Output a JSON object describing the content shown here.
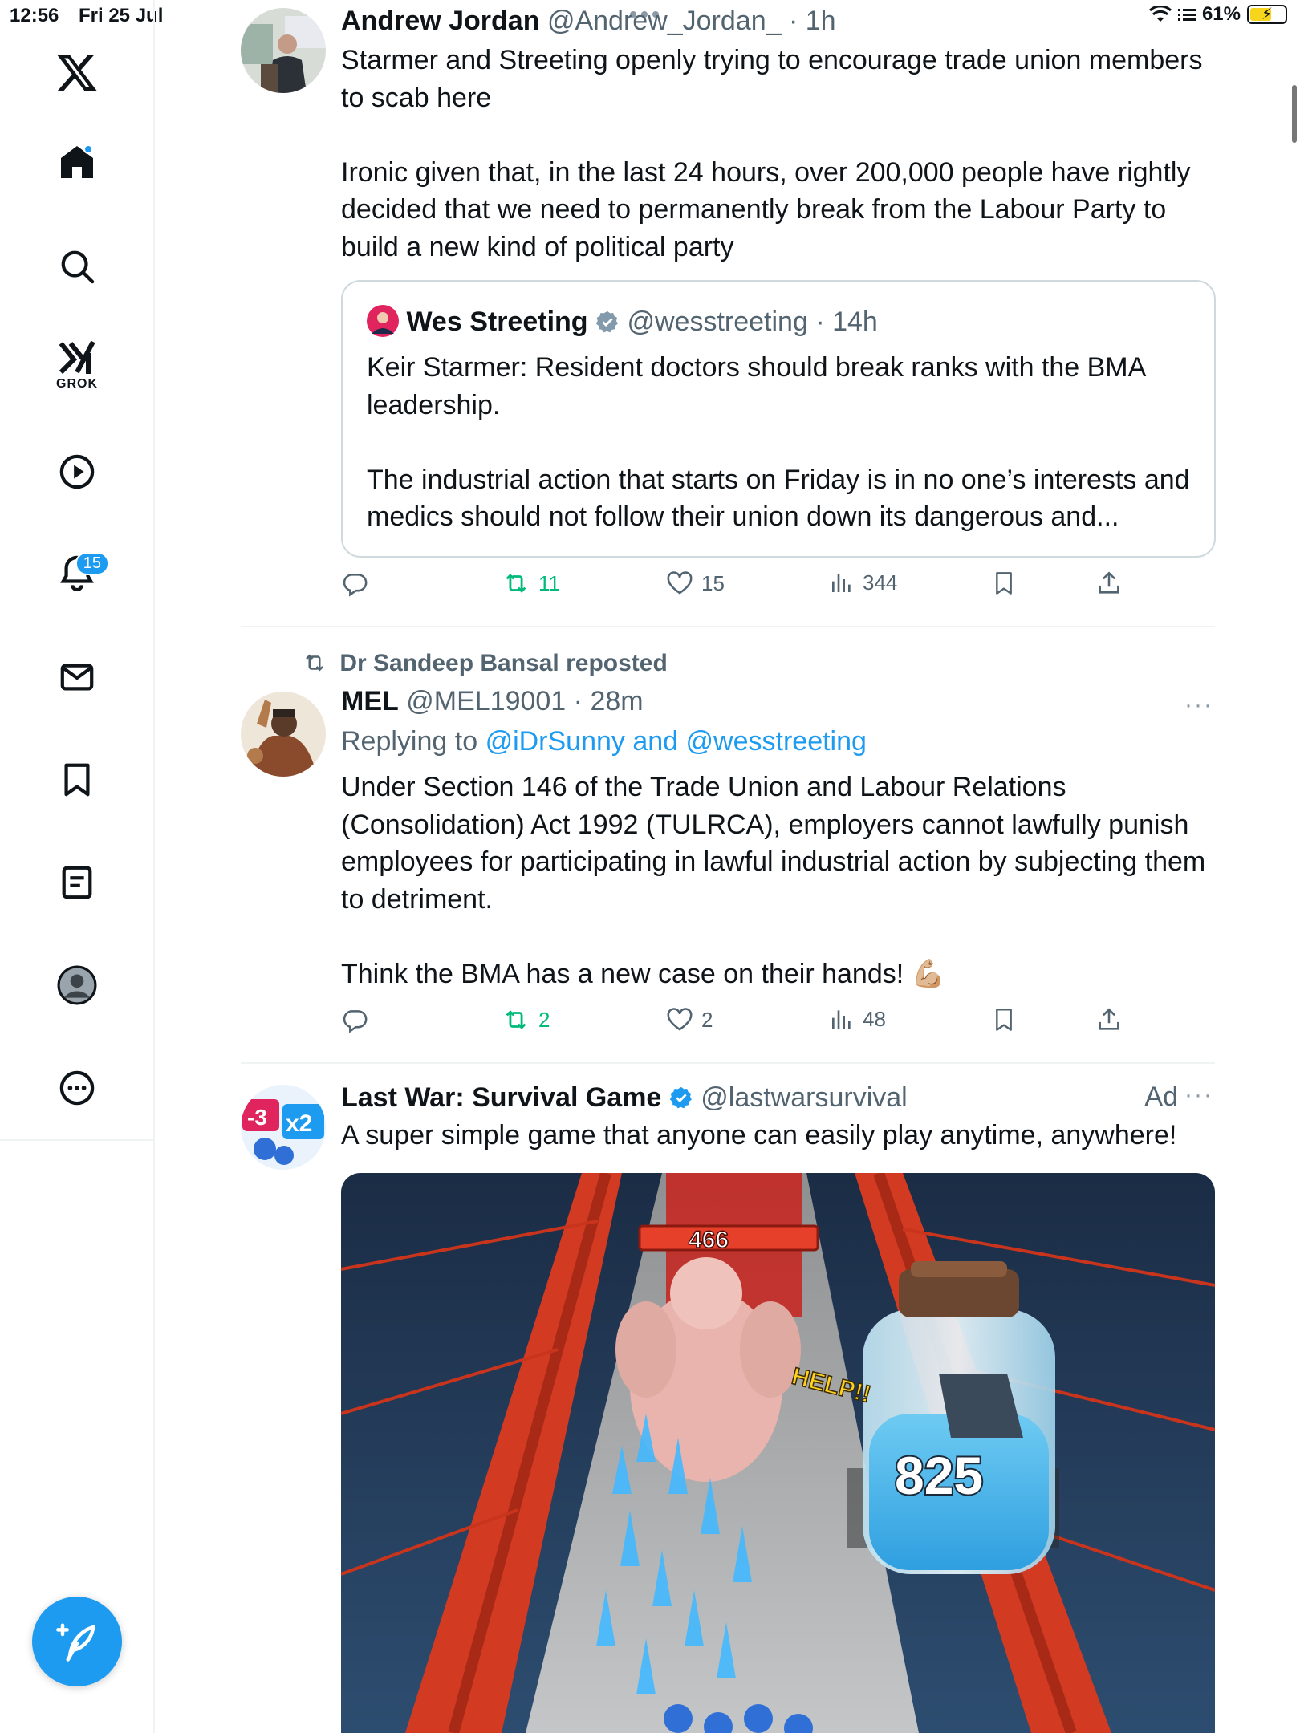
{
  "status_bar": {
    "time": "12:56",
    "date": "Fri 25 Jul",
    "battery": "61%"
  },
  "sidebar": {
    "items": [
      {
        "name": "x-logo-icon"
      },
      {
        "name": "home-icon"
      },
      {
        "name": "search-icon"
      },
      {
        "name": "grok-icon",
        "label": "GROK"
      },
      {
        "name": "video-icon"
      },
      {
        "name": "notifications-icon",
        "badge": "15"
      },
      {
        "name": "messages-icon"
      },
      {
        "name": "bookmarks-icon"
      },
      {
        "name": "lists-icon"
      },
      {
        "name": "profile-icon"
      },
      {
        "name": "more-icon"
      }
    ]
  },
  "feed": {
    "tweets": [
      {
        "name": "Andrew Jordan",
        "handle": "@Andrew_Jordan_",
        "time": "· 1h",
        "text": "Starmer and Streeting openly trying to encourage trade union members to scab here\n\nIronic given that, in the last 24 hours, over 200,000 people have rightly decided that we need to permanently break from the Labour Party to build a new kind of political party",
        "quote": {
          "name": "Wes Streeting",
          "handle": "@wesstreeting",
          "time": "· 14h",
          "text": "Keir Starmer: Resident doctors should break ranks with the BMA leadership.\n\nThe industrial action that starts on Friday is in no one’s interests and medics should not follow their union down its dangerous and..."
        },
        "stats": {
          "reposts": "11",
          "likes": "15",
          "views": "344"
        }
      },
      {
        "reposted_by": "Dr Sandeep Bansal reposted",
        "name": "MEL",
        "handle": "@MEL19001",
        "time": "· 28m",
        "replying_prefix": "Replying to",
        "replying_to": "@iDrSunny and @wesstreeting",
        "text": "Under Section 146 of the Trade Union and Labour Relations (Consolidation) Act 1992 (TULRCA), employers cannot lawfully punish employees for participating in lawful industrial action by subjecting them to detriment.\n\nThink the BMA has a new case on their hands!",
        "emoji": "💪🏼",
        "stats": {
          "reposts": "2",
          "likes": "2",
          "views": "48"
        }
      },
      {
        "name": "Last War: Survival Game",
        "handle": "@lastwarsurvival",
        "ad_label": "Ad",
        "text": "A super simple game that anyone can easily play anytime, anywhere!",
        "media": {
          "bar_value": "466",
          "bottle_value": "825",
          "help_text": "HELP!!"
        }
      }
    ]
  },
  "colors": {
    "accent": "#1d9bf0",
    "repost_green": "#00ba7c",
    "secondary_text": "#536471"
  }
}
